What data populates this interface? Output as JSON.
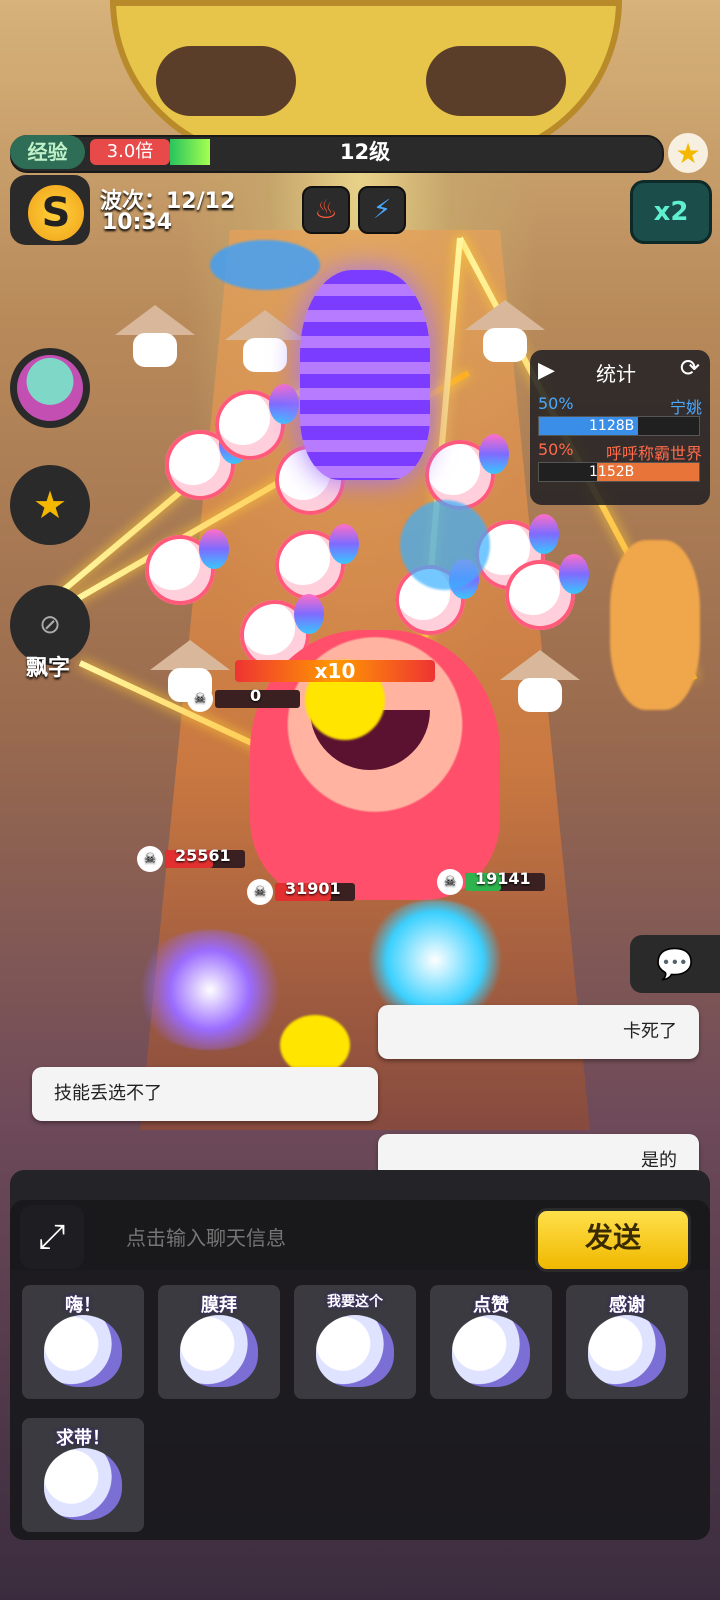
{
  "hud": {
    "exp_label": "经验",
    "multiplier": "3.0倍",
    "level": "12级",
    "wave": "波次：12/12",
    "time": "10:34",
    "badge_letter": "S",
    "speed": "x2",
    "exp_progress": 0.07
  },
  "side": {
    "float_text_label": "飘字"
  },
  "stats": {
    "title": "统计",
    "rows": [
      {
        "percent": "50%",
        "name": "宁姚",
        "value": "1128B",
        "color": "#3a8ee8",
        "name_color": "#4aa8ff"
      },
      {
        "percent": "50%",
        "name": "呼呼称霸世界",
        "value": "1152B",
        "color": "#e8743a",
        "name_color": "#ff6a4a"
      }
    ]
  },
  "battle": {
    "combo": "x10",
    "hp_labels": [
      "0",
      "25561",
      "31901",
      "19141"
    ]
  },
  "chat_bubbles": [
    {
      "text": "卡死了"
    },
    {
      "text": "技能丢选不了"
    },
    {
      "text": "是的"
    }
  ],
  "chat": {
    "placeholder": "点击输入聊天信息",
    "send_label": "发送",
    "stickers": [
      "嗨！",
      "膜拜",
      "我要这个",
      "点赞",
      "感谢",
      "求带！"
    ]
  },
  "colors": {
    "send": "#f0b800",
    "speed": "#5ff0d0",
    "exp_fill": "#27c45e"
  }
}
